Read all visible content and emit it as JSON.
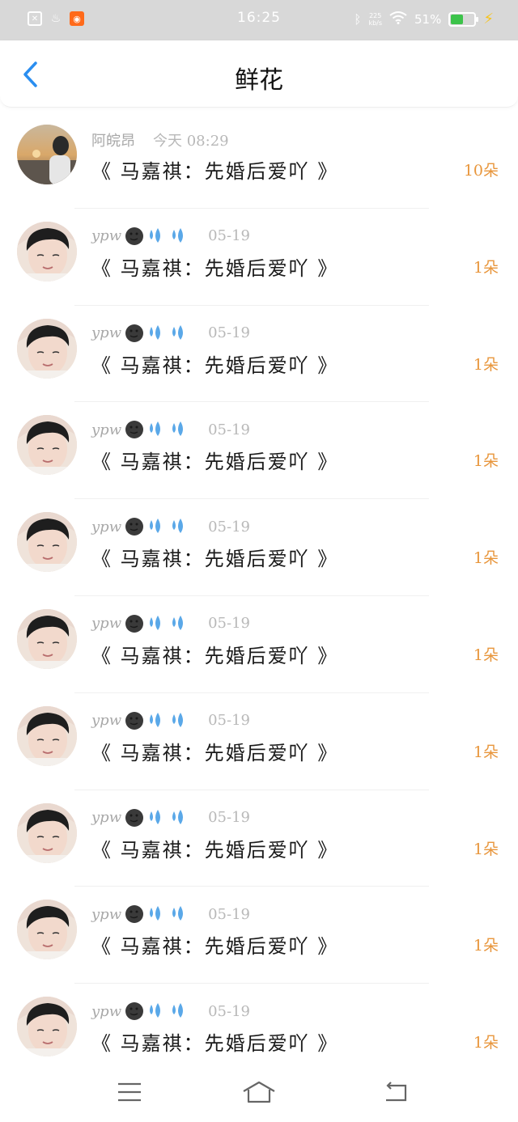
{
  "status_bar": {
    "time": "16:25",
    "speed_top": "225",
    "speed_bottom": "kb/s",
    "battery": "51%",
    "battery_level": 0.51,
    "icons": [
      "sim-icon",
      "fire-icon",
      "app-icon",
      "bluetooth-icon",
      "wifi-icon",
      "battery-icon",
      "charging-bolt-icon"
    ]
  },
  "header": {
    "title": "鲜花",
    "back_icon": "chevron-left-icon"
  },
  "colors": {
    "accent": "#2a8ef0",
    "count": "#e8963c",
    "meta": "#b0b0b0"
  },
  "items": [
    {
      "user": "阿皖昂",
      "date": "今天 08:29",
      "book": "《 马嘉祺：先婚后爱吖 》",
      "count": "10朵",
      "avatar": "sunset-photo"
    },
    {
      "user": "ypw",
      "date": "05-19",
      "book": "《 马嘉祺：先婚后爱吖 》",
      "count": "1朵",
      "avatar": "portrait"
    },
    {
      "user": "ypw",
      "date": "05-19",
      "book": "《 马嘉祺：先婚后爱吖 》",
      "count": "1朵",
      "avatar": "portrait"
    },
    {
      "user": "ypw",
      "date": "05-19",
      "book": "《 马嘉祺：先婚后爱吖 》",
      "count": "1朵",
      "avatar": "portrait"
    },
    {
      "user": "ypw",
      "date": "05-19",
      "book": "《 马嘉祺：先婚后爱吖 》",
      "count": "1朵",
      "avatar": "portrait"
    },
    {
      "user": "ypw",
      "date": "05-19",
      "book": "《 马嘉祺：先婚后爱吖 》",
      "count": "1朵",
      "avatar": "portrait"
    },
    {
      "user": "ypw",
      "date": "05-19",
      "book": "《 马嘉祺：先婚后爱吖 》",
      "count": "1朵",
      "avatar": "portrait"
    },
    {
      "user": "ypw",
      "date": "05-19",
      "book": "《 马嘉祺：先婚后爱吖 》",
      "count": "1朵",
      "avatar": "portrait"
    },
    {
      "user": "ypw",
      "date": "05-19",
      "book": "《 马嘉祺：先婚后爱吖 》",
      "count": "1朵",
      "avatar": "portrait"
    },
    {
      "user": "ypw",
      "date": "05-19",
      "book": "《 马嘉祺：先婚后爱吖 》",
      "count": "1朵",
      "avatar": "portrait"
    }
  ],
  "nav": {
    "icons": [
      "menu-icon",
      "home-icon",
      "back-icon"
    ]
  }
}
